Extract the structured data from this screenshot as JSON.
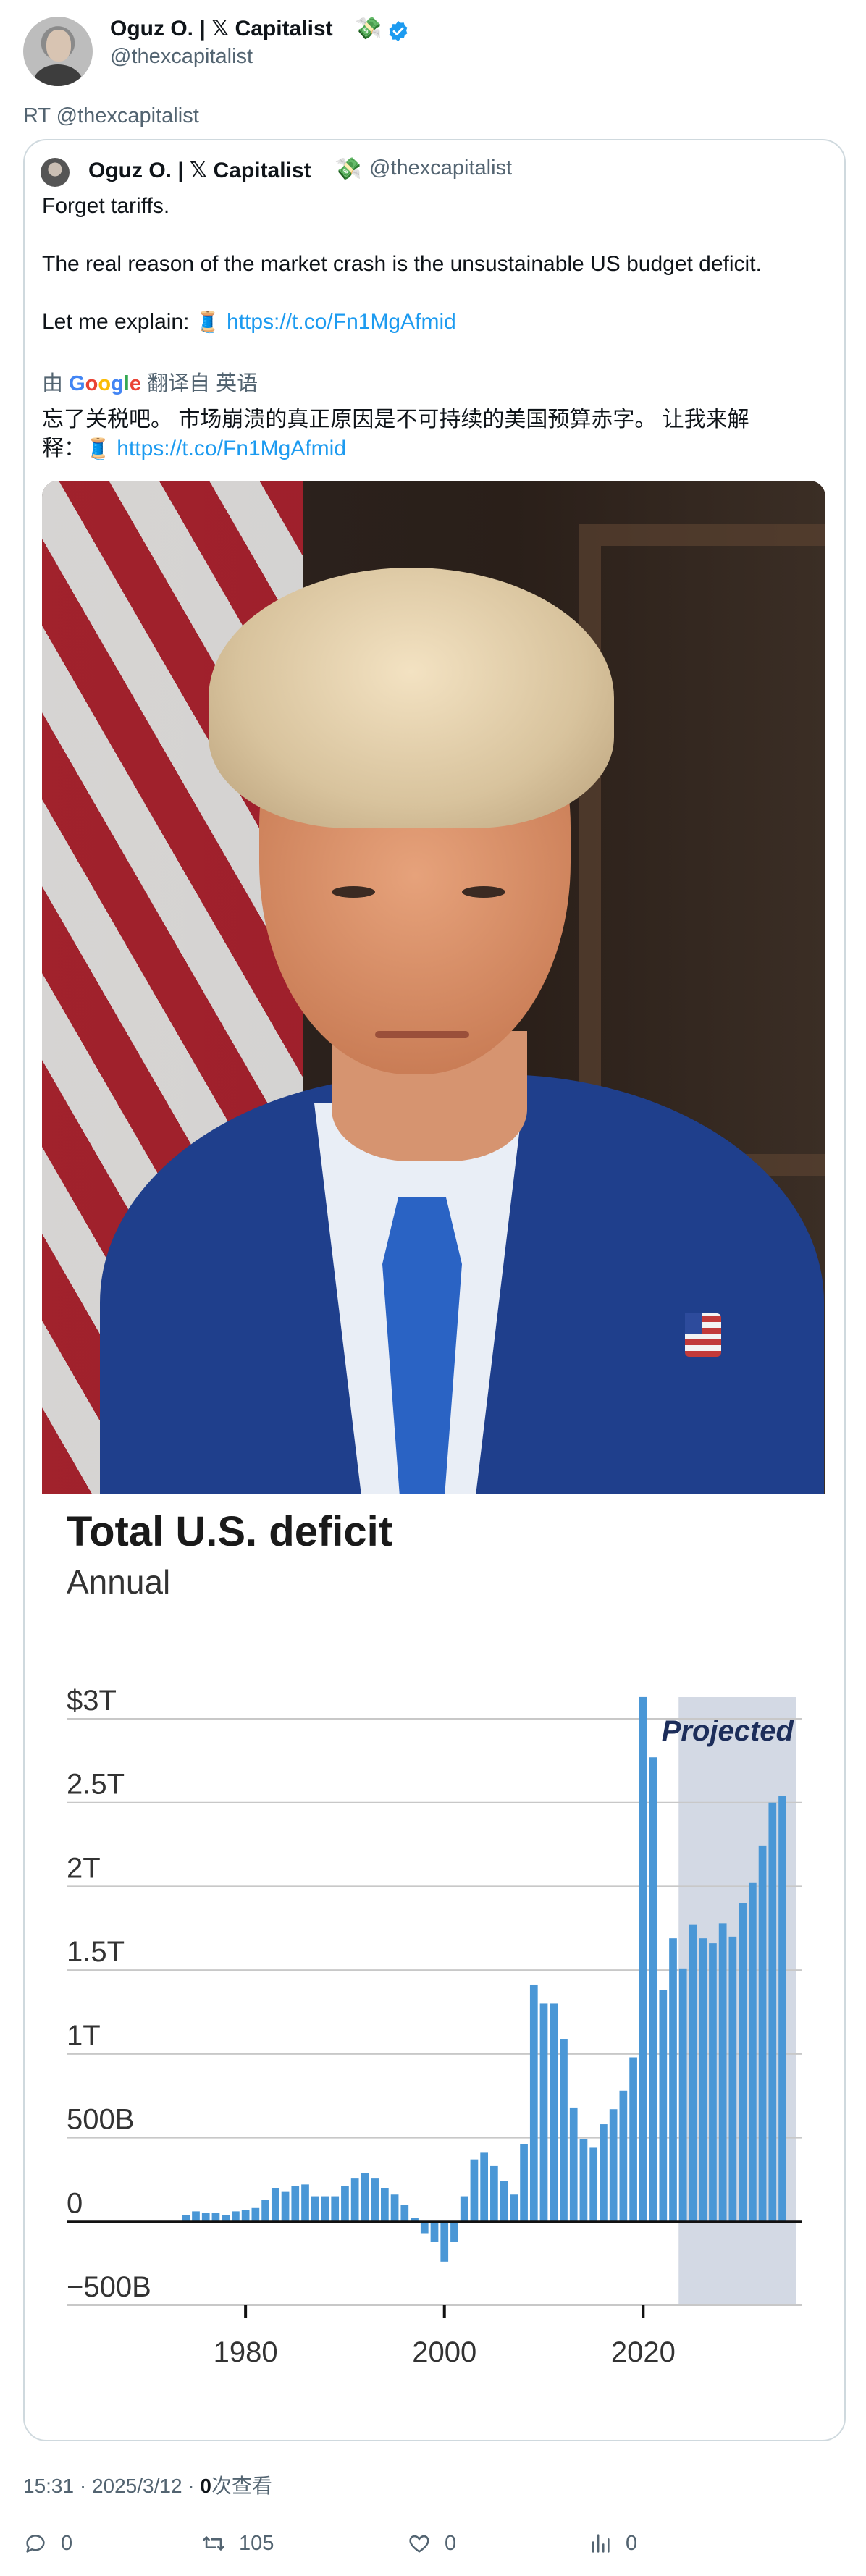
{
  "author": {
    "name": "Oguz O. | 𝕏 Capitalist",
    "emoji": "💸",
    "handle": "@thexcapitalist",
    "verified_color": "#1d9bf0"
  },
  "retweet_line": "RT @thexcapitalist",
  "quoted": {
    "name": "Oguz O. | 𝕏 Capitalist",
    "emoji": "💸",
    "handle": "@thexcapitalist",
    "line1": "Forget tariffs.",
    "line2": "The real reason of the market crash is the unsustainable US budget deficit.",
    "line3_prefix": "Let me explain: ",
    "spool": "🧵",
    "link": "https://t.co/Fn1MgAfmid",
    "translated_prefix": "由",
    "translated_suffix": "翻译自 英语",
    "zh_line1": "忘了关税吧。 市场崩溃的真正原因是不可持续的美国预算赤字。 让我来解",
    "zh_line2_prefix": "释：",
    "zh_link": "https://t.co/Fn1MgAfmid"
  },
  "chart_data": {
    "type": "bar",
    "title": "Total U.S. deficit",
    "subtitle": "Annual",
    "annotation": "Projected",
    "projected_from": 2024,
    "bar_color": "#4a97d6",
    "projected_shade": "#d3d9e4",
    "y_ticks": [
      {
        "value": 3000,
        "label": "$3T"
      },
      {
        "value": 2500,
        "label": "2.5T"
      },
      {
        "value": 2000,
        "label": "2T"
      },
      {
        "value": 1500,
        "label": "1.5T"
      },
      {
        "value": 1000,
        "label": "1T"
      },
      {
        "value": 500,
        "label": "500B"
      },
      {
        "value": 0,
        "label": "0"
      },
      {
        "value": -500,
        "label": "−500B"
      }
    ],
    "x_ticks": [
      1980,
      2000,
      2020
    ],
    "ylim": [
      -500,
      3000
    ],
    "xlim": [
      1962,
      2036
    ],
    "years": [
      1974,
      1975,
      1976,
      1977,
      1978,
      1979,
      1980,
      1981,
      1982,
      1983,
      1984,
      1985,
      1986,
      1987,
      1988,
      1989,
      1990,
      1991,
      1992,
      1993,
      1994,
      1995,
      1996,
      1997,
      1998,
      1999,
      2000,
      2001,
      2002,
      2003,
      2004,
      2005,
      2006,
      2007,
      2008,
      2009,
      2010,
      2011,
      2012,
      2013,
      2014,
      2015,
      2016,
      2017,
      2018,
      2019,
      2020,
      2021,
      2022,
      2023,
      2024,
      2025,
      2026,
      2027,
      2028,
      2029,
      2030,
      2031,
      2032,
      2033,
      2034
    ],
    "values": [
      40,
      60,
      50,
      50,
      40,
      60,
      70,
      80,
      130,
      200,
      180,
      210,
      220,
      150,
      150,
      150,
      210,
      260,
      290,
      260,
      200,
      160,
      100,
      20,
      -70,
      -120,
      -240,
      -120,
      150,
      370,
      410,
      330,
      240,
      160,
      460,
      1410,
      1300,
      1300,
      1090,
      680,
      490,
      440,
      580,
      670,
      780,
      980,
      3130,
      2770,
      1380,
      1690,
      1510,
      1770,
      1690,
      1660,
      1780,
      1700,
      1900,
      2020,
      2240,
      2500,
      2540
    ]
  },
  "footer": {
    "time": "15:31 · 2025/3/12 · ",
    "views_count": "0",
    "views_label": "次查看"
  },
  "actions": [
    {
      "icon": "reply-icon",
      "count": "0"
    },
    {
      "icon": "retweet-icon",
      "count": "105"
    },
    {
      "icon": "like-icon",
      "count": "0"
    },
    {
      "icon": "views-icon",
      "count": "0"
    }
  ]
}
